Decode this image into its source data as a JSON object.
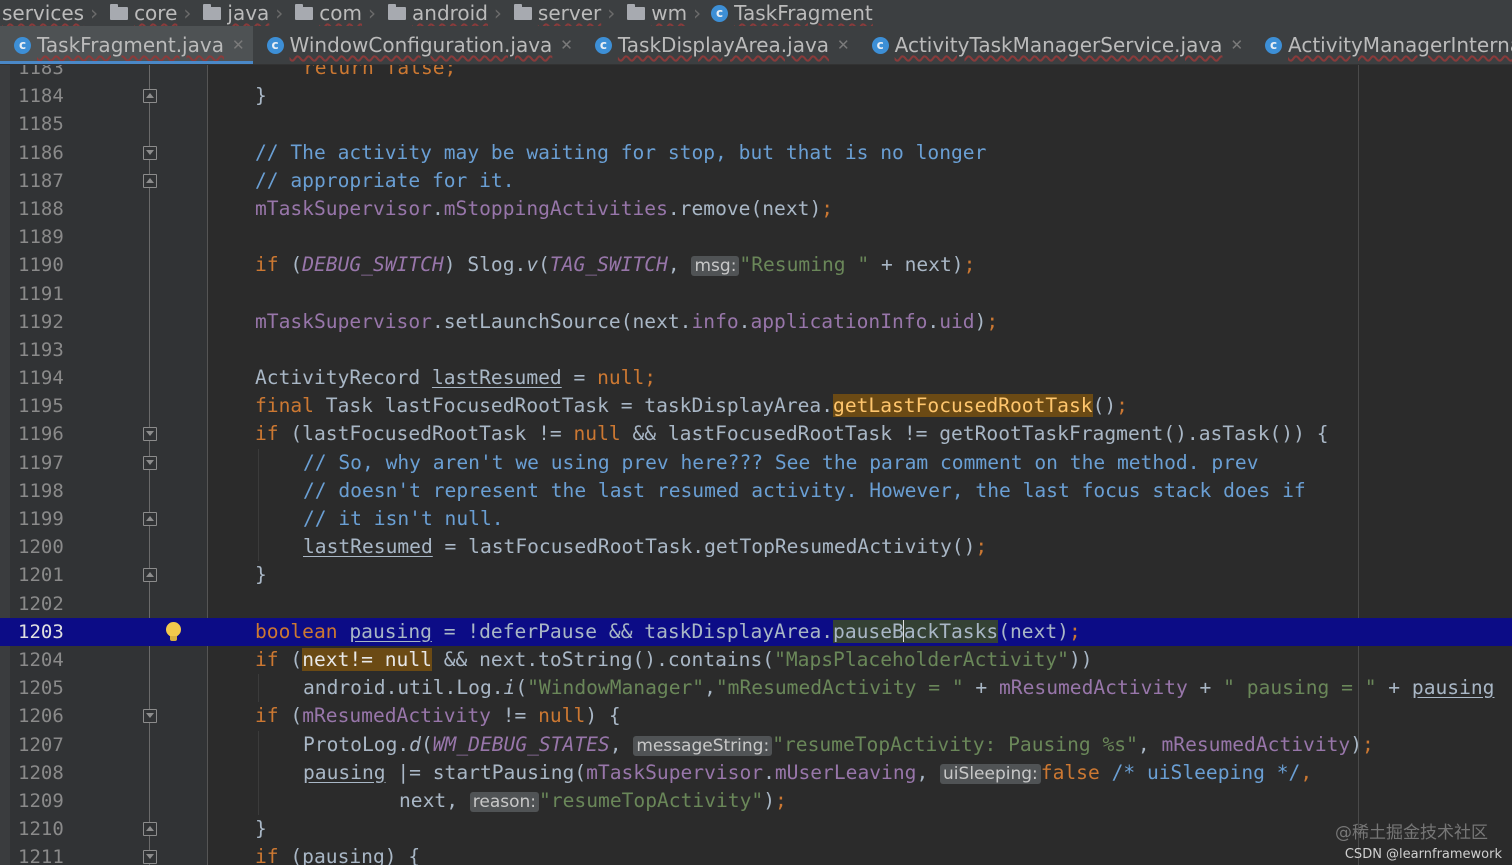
{
  "breadcrumb": {
    "items": [
      {
        "label": "services",
        "icon": "none"
      },
      {
        "label": "core",
        "icon": "folder-icon"
      },
      {
        "label": "java",
        "icon": "folder-icon"
      },
      {
        "label": "com",
        "icon": "folder-icon"
      },
      {
        "label": "android",
        "icon": "folder-icon"
      },
      {
        "label": "server",
        "icon": "folder-icon"
      },
      {
        "label": "wm",
        "icon": "folder-icon"
      },
      {
        "label": "TaskFragment",
        "icon": "class-icon"
      }
    ]
  },
  "tabs": [
    {
      "label": "TaskFragment.java",
      "active": true,
      "icon": "class-icon"
    },
    {
      "label": "WindowConfiguration.java",
      "active": false,
      "icon": "class-icon"
    },
    {
      "label": "TaskDisplayArea.java",
      "active": false,
      "icon": "class-icon"
    },
    {
      "label": "ActivityTaskManagerService.java",
      "active": false,
      "icon": "class-icon"
    },
    {
      "label": "ActivityManagerInternal.java",
      "active": false,
      "icon": "class-icon"
    }
  ],
  "editor": {
    "current_line": "1203",
    "line_numbers": [
      "1183",
      "1184",
      "1185",
      "1186",
      "1187",
      "1188",
      "1189",
      "1190",
      "1191",
      "1192",
      "1193",
      "1194",
      "1195",
      "1196",
      "1197",
      "1198",
      "1199",
      "1200",
      "1201",
      "1202",
      "1203",
      "1204",
      "1205",
      "1206",
      "1207",
      "1208",
      "1209",
      "1210",
      "1211"
    ],
    "code": {
      "l1183": "return false;",
      "l1184": "}",
      "l1186": "// The activity may be waiting for stop, but that is no longer",
      "l1187": "// appropriate for it.",
      "l1188_a": "mTaskSupervisor",
      "l1188_b": ".",
      "l1188_c": "mStoppingActivities",
      "l1188_d": ".remove(next)",
      "l1188_e": ";",
      "l1190_kw": "if",
      "l1190_a": " (",
      "l1190_b": "DEBUG_SWITCH",
      "l1190_c": ") Slog.",
      "l1190_d": "v",
      "l1190_e": "(",
      "l1190_f": "TAG_SWITCH",
      "l1190_g": ", ",
      "l1190_hint": "msg:",
      "l1190_str": "\"Resuming \"",
      "l1190_h": " + next)",
      "l1190_i": ";",
      "l1192_a": "mTaskSupervisor",
      "l1192_b": ".setLaunchSource(next.",
      "l1192_c": "info",
      "l1192_d": ".",
      "l1192_e": "applicationInfo",
      "l1192_f": ".",
      "l1192_g": "uid",
      "l1192_h": ")",
      "l1192_i": ";",
      "l1194_a": "ActivityRecord ",
      "l1194_b": "lastResumed",
      "l1194_c": " = ",
      "l1194_kw": "null",
      "l1194_d": ";",
      "l1195_kw": "final",
      "l1195_a": " Task lastFocusedRootTask = taskDisplayArea.",
      "l1195_b": "getLastFocusedRootTask",
      "l1195_c": "()",
      "l1195_d": ";",
      "l1196_kw": "if",
      "l1196_a": " (lastFocusedRootTask != ",
      "l1196_kw2": "null",
      "l1196_b": " && lastFocusedRootTask != getRootTaskFragment().asTask()) {",
      "l1197": "// So, why aren't we using prev here??? See the param comment on the method. prev",
      "l1198": "// doesn't represent the last resumed activity. However, the last focus stack does if",
      "l1199": "// it isn't null.",
      "l1200_a": "lastResumed",
      "l1200_b": " = lastFocusedRootTask.getTopResumedActivity()",
      "l1200_c": ";",
      "l1201": "}",
      "l1203_kw": "boolean",
      "l1203_a": " ",
      "l1203_b": "pausing",
      "l1203_c": " = !deferPause && taskDisplayArea.",
      "l1203_d": "pauseB",
      "l1203_e": "ackTasks",
      "l1203_f": "(next)",
      "l1203_g": ";",
      "l1204_kw": "if",
      "l1204_a": " (",
      "l1204_b": "next!= null",
      "l1204_c": " && next.toString().contains(",
      "l1204_str": "\"MapsPlaceholderActivity\"",
      "l1204_d": "))",
      "l1205_a": "android.util.Log.",
      "l1205_b": "i",
      "l1205_c": "(",
      "l1205_str1": "\"WindowManager\"",
      "l1205_d": ",",
      "l1205_str2": "\"mResumedActivity = \"",
      "l1205_e": " + ",
      "l1205_f": "mResumedActivity",
      "l1205_g": " + ",
      "l1205_str3": "\" pausing = \"",
      "l1205_h": " + ",
      "l1205_i": "pausing",
      "l1206_kw": "if",
      "l1206_a": " (",
      "l1206_b": "mResumedActivity",
      "l1206_c": " != ",
      "l1206_kw2": "null",
      "l1206_d": ") {",
      "l1207_a": "ProtoLog.",
      "l1207_b": "d",
      "l1207_c": "(",
      "l1207_d": "WM_DEBUG_STATES",
      "l1207_e": ", ",
      "l1207_hint": "messageString:",
      "l1207_str": "\"resumeTopActivity: Pausing %s\"",
      "l1207_f": ", ",
      "l1207_g": "mResumedActivity",
      "l1207_h": ")",
      "l1207_i": ";",
      "l1208_a": "pausing",
      "l1208_b": " |= startPausing(",
      "l1208_c": "mTaskSupervisor",
      "l1208_d": ".",
      "l1208_e": "mUserLeaving",
      "l1208_f": ", ",
      "l1208_hint": "uiSleeping:",
      "l1208_kw": "false",
      "l1208_g": " ",
      "l1208_cm": "/* uiSleeping */",
      "l1208_h": ",",
      "l1209_a": "next",
      "l1209_b": ", ",
      "l1209_hint": "reason:",
      "l1209_str": "\"resumeTopActivity\"",
      "l1209_c": ")",
      "l1209_d": ";",
      "l1210": "}",
      "l1211_kw": "if",
      "l1211_a": " (pausing) {"
    }
  },
  "watermark": {
    "line1": "@稀土掘金技术社区",
    "line2": "CSDN @learnframework"
  },
  "colors": {
    "background": "#2b2b2b",
    "current_line": "#0c0c86",
    "keyword": "#cc7832",
    "string": "#6a8759",
    "field": "#9876aa",
    "comment": "#6a9fd4"
  }
}
